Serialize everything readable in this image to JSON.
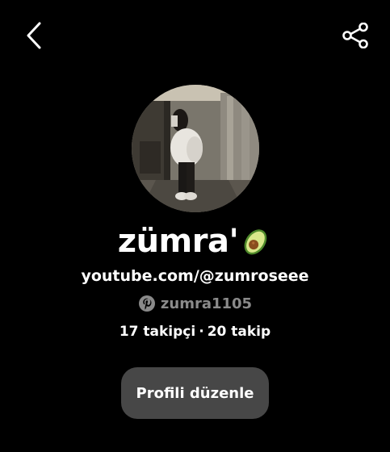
{
  "header": {
    "back_icon": "chevron-left-icon",
    "share_icon": "share-icon"
  },
  "profile": {
    "display_name": "zümra'",
    "name_emoji": "avocado-emoji",
    "website": "youtube.com/@zumroseee",
    "pinterest_icon": "pinterest-icon",
    "username": "zumra1105",
    "followers": "17 takipçi",
    "separator": "·",
    "following": "20 takip",
    "edit_label": "Profili düzenle"
  },
  "colors": {
    "background": "#000000",
    "text": "#ffffff",
    "muted": "#8a8a8a",
    "button_bg": "#474747"
  }
}
